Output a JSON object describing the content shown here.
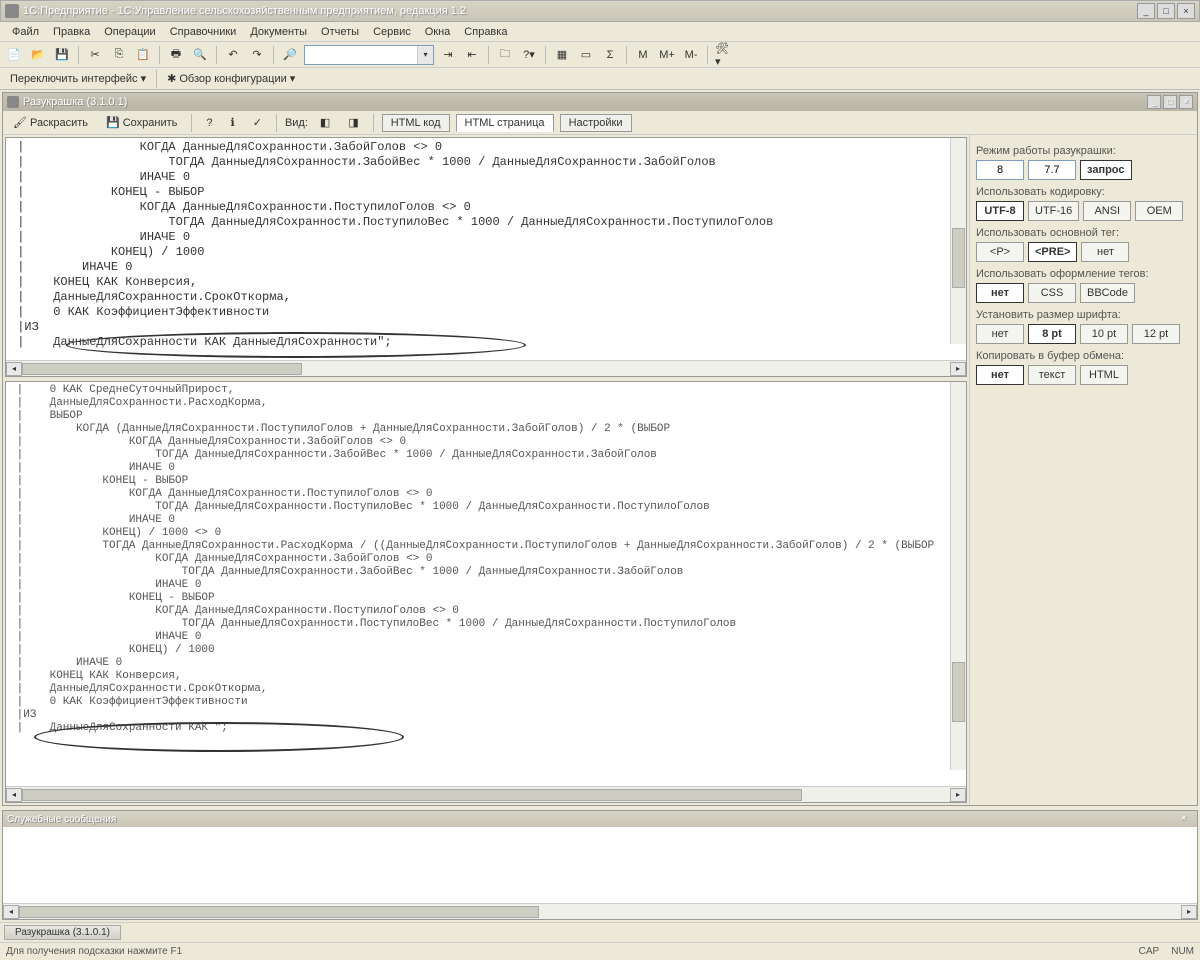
{
  "app": {
    "title": "1С:Предприятие - 1С:Управление сельскохозяйственным предприятием, редакция 1.2"
  },
  "menu": [
    "Файл",
    "Правка",
    "Операции",
    "Справочники",
    "Документы",
    "Отчеты",
    "Сервис",
    "Окна",
    "Справка"
  ],
  "toolbar2": {
    "switch_interface": "Переключить интерфейс",
    "config_overview": "Обзор конфигурации"
  },
  "toolbar_marks": {
    "m": "М",
    "mplus": "М+",
    "mminus": "М-"
  },
  "child": {
    "title": "Разукрашка (3.1.0.1)",
    "toolbar": {
      "colorize": "Раскрасить",
      "save": "Сохранить",
      "view": "Вид:",
      "html_code": "HTML код",
      "html_page": "HTML страница",
      "settings": "Настройки"
    }
  },
  "side": {
    "mode_label": "Режим работы разукрашки:",
    "mode_v1": "8",
    "mode_v2": "7.7",
    "mode_btn": "запрос",
    "encoding_label": "Использовать кодировку:",
    "enc": [
      "UTF-8",
      "UTF-16",
      "ANSI",
      "OEM"
    ],
    "maintag_label": "Использовать основной тег:",
    "tags": [
      "<P>",
      "<PRE>",
      "нет"
    ],
    "tagfmt_label": "Использовать оформление тегов:",
    "tagfmt": [
      "нет",
      "CSS",
      "BBCode"
    ],
    "font_label": "Установить размер шрифта:",
    "fonts": [
      "нет",
      "8 pt",
      "10 pt",
      "12 pt"
    ],
    "clip_label": "Копировать в буфер обмена:",
    "clip": [
      "нет",
      "текст",
      "HTML"
    ]
  },
  "code_top": " |                КОГДА ДанныеДляСохранности.ЗабойГолов <> 0\n |                    ТОГДА ДанныеДляСохранности.ЗабойВес * 1000 / ДанныеДляСохранности.ЗабойГолов\n |                ИНАЧЕ 0\n |            КОНЕЦ - ВЫБОР\n |                КОГДА ДанныеДляСохранности.ПоступилоГолов <> 0\n |                    ТОГДА ДанныеДляСохранности.ПоступилоВес * 1000 / ДанныеДляСохранности.ПоступилоГолов\n |                ИНАЧЕ 0\n |            КОНЕЦ) / 1000\n |        ИНАЧЕ 0\n |    КОНЕЦ КАК Конверсия,\n |    ДанныеДляСохранности.СрокОткорма,\n |    0 КАК КоэффициентЭффективности\n |ИЗ\n |    ДанныеДляСохранности КАК ДанныеДляСохранности\";",
  "code_bot": " |    0 КАК СреднеСуточныйПрирост,\n |    ДанныеДляСохранности.РасходКорма,\n |    ВЫБОР\n |        КОГДА (ДанныеДляСохранности.ПоступилоГолов + ДанныеДляСохранности.ЗабойГолов) / 2 * (ВЫБОР\n |                КОГДА ДанныеДляСохранности.ЗабойГолов <> 0\n |                    ТОГДА ДанныеДляСохранности.ЗабойВес * 1000 / ДанныеДляСохранности.ЗабойГолов\n |                ИНАЧЕ 0\n |            КОНЕЦ - ВЫБОР\n |                КОГДА ДанныеДляСохранности.ПоступилоГолов <> 0\n |                    ТОГДА ДанныеДляСохранности.ПоступилоВес * 1000 / ДанныеДляСохранности.ПоступилоГолов\n |                ИНАЧЕ 0\n |            КОНЕЦ) / 1000 <> 0\n |            ТОГДА ДанныеДляСохранности.РасходКорма / ((ДанныеДляСохранности.ПоступилоГолов + ДанныеДляСохранности.ЗабойГолов) / 2 * (ВЫБОР\n |                    КОГДА ДанныеДляСохранности.ЗабойГолов <> 0\n |                        ТОГДА ДанныеДляСохранности.ЗабойВес * 1000 / ДанныеДляСохранности.ЗабойГолов\n |                    ИНАЧЕ 0\n |                КОНЕЦ - ВЫБОР\n |                    КОГДА ДанныеДляСохранности.ПоступилоГолов <> 0\n |                        ТОГДА ДанныеДляСохранности.ПоступилоВес * 1000 / ДанныеДляСохранности.ПоступилоГолов\n |                    ИНАЧЕ 0\n |                КОНЕЦ) / 1000\n |        ИНАЧЕ 0\n |    КОНЕЦ КАК Конверсия,\n |    ДанныеДляСохранности.СрокОткорма,\n |    0 КАК КоэффициентЭффективности\n |ИЗ\n |    ДанныеДляСохранности КАК \";",
  "msg": {
    "title": "Служебные сообщения"
  },
  "taskbar": {
    "item": "Разукрашка (3.1.0.1)"
  },
  "status": {
    "hint": "Для получения подсказки нажмите F1",
    "cap": "CAP",
    "num": "NUM"
  }
}
